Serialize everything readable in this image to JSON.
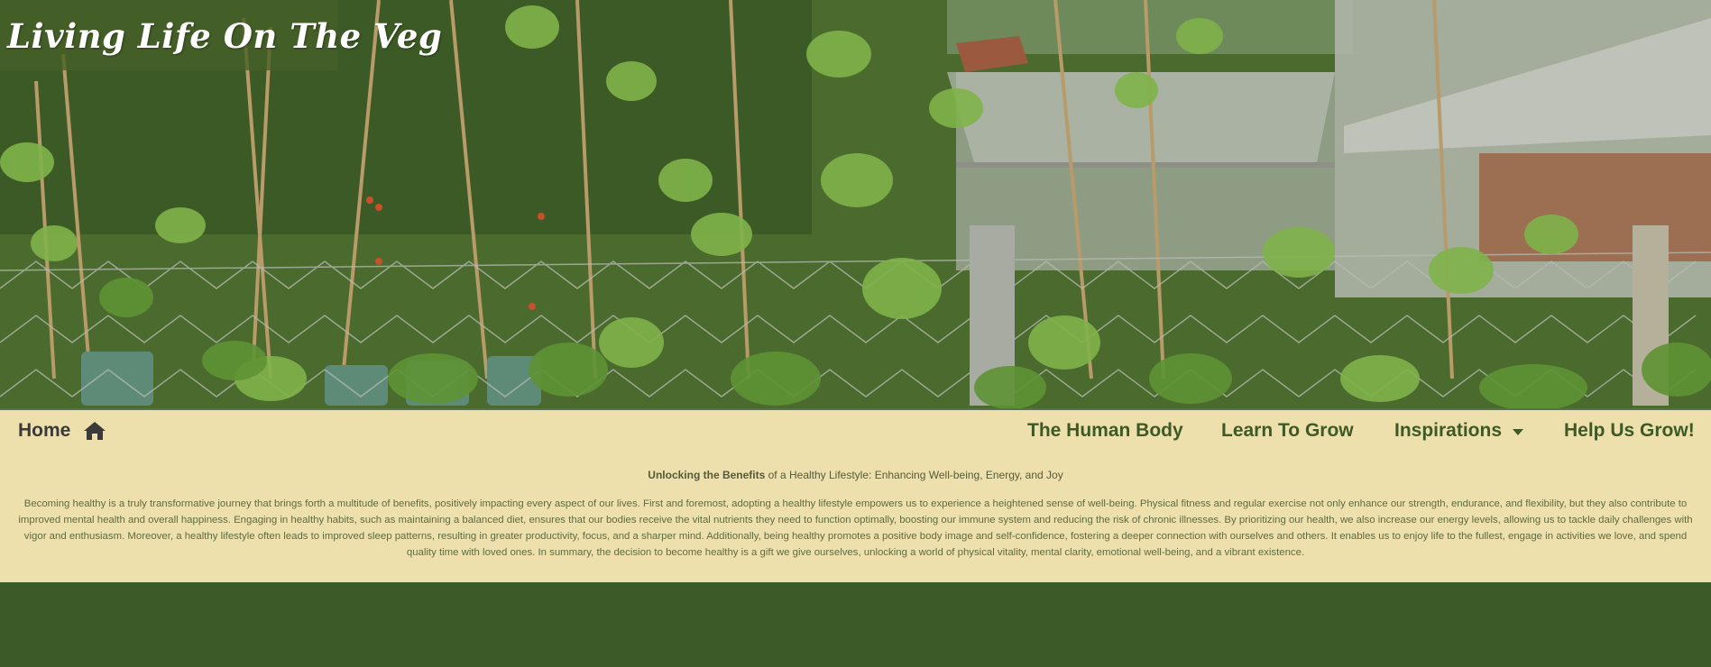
{
  "brand": {
    "title": "Living Life On The Veg"
  },
  "nav": {
    "home_label": "Home",
    "home_icon": "house-icon",
    "items": [
      {
        "label": "The Human Body"
      },
      {
        "label": "Learn To Grow"
      },
      {
        "label": "Inspirations",
        "has_dropdown": true
      },
      {
        "label": "Help Us Grow!"
      }
    ]
  },
  "article": {
    "heading_bold": "Unlocking the Benefits",
    "heading_rest": " of a Healthy Lifestyle: Enhancing Well-being, Energy, and Joy",
    "body": "Becoming healthy is a truly transformative journey that brings forth a multitude of benefits, positively impacting every aspect of our lives. First and foremost, adopting a healthy lifestyle empowers us to experience a heightened sense of well-being. Physical fitness and regular exercise not only enhance our strength, endurance, and flexibility, but they also contribute to improved mental health and overall happiness. Engaging in healthy habits, such as maintaining a balanced diet, ensures that our bodies receive the vital nutrients they need to function optimally, boosting our immune system and reducing the risk of chronic illnesses. By prioritizing our health, we also increase our energy levels, allowing us to tackle daily challenges with vigor and enthusiasm. Moreover, a healthy lifestyle often leads to improved sleep patterns, resulting in greater productivity, focus, and a sharper mind. Additionally, being healthy promotes a positive body image and self-confidence, fostering a deeper connection with ourselves and others. It enables us to enjoy life to the fullest, engage in activities we love, and spend quality time with loved ones. In summary, the decision to become healthy is a gift we give ourselves, unlocking a world of physical vitality, mental clarity, emotional well-being, and a vibrant existence."
  },
  "colors": {
    "nav_bg": "#ede0ad",
    "nav_text": "#3d5a26",
    "footer_bg": "#3b5a28",
    "body_text": "#5f6a3e"
  }
}
